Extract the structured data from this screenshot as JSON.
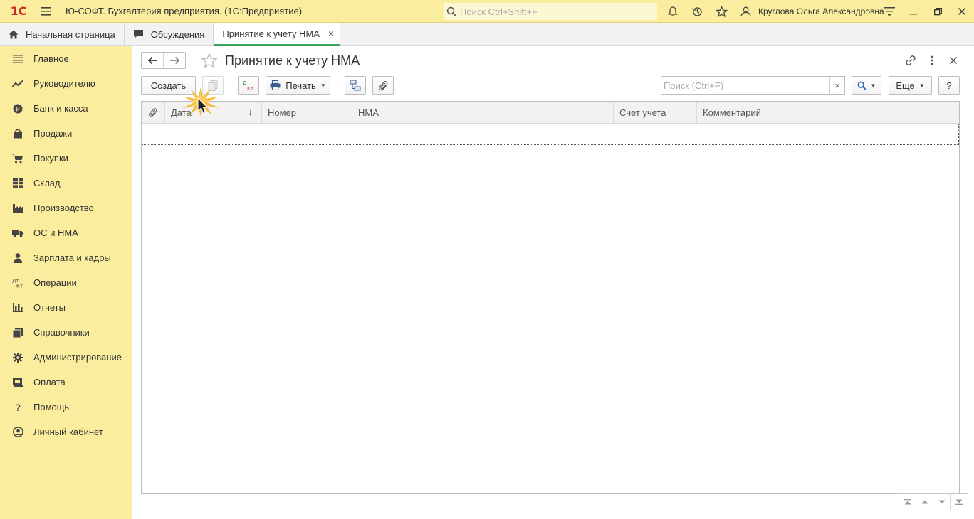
{
  "app": {
    "logo_text": "1С",
    "title": "Ю-СОФТ. Бухгалтерия предприятия.  (1С:Предприятие)",
    "search_placeholder": "Поиск Ctrl+Shift+F",
    "user_name": "Круглова Ольга Александровна",
    "icons": [
      "menu-icon",
      "search-icon",
      "bell-icon",
      "history-icon",
      "star-icon",
      "user-icon",
      "settings-icon"
    ],
    "accent_color": "#fbed9e"
  },
  "tabs": [
    {
      "label": "Начальная страница",
      "icon": "home-icon"
    },
    {
      "label": "Обсуждения",
      "icon": "chat-icon"
    },
    {
      "label": "Принятие к учету НМА",
      "active": true,
      "close": "×"
    }
  ],
  "sidebar": {
    "items": [
      {
        "label": "Главное",
        "icon": "list-icon"
      },
      {
        "label": "Руководителю",
        "icon": "trend-icon"
      },
      {
        "label": "Банк и касса",
        "icon": "coin-icon"
      },
      {
        "label": "Продажи",
        "icon": "bag-icon"
      },
      {
        "label": "Покупки",
        "icon": "cart-icon"
      },
      {
        "label": "Склад",
        "icon": "warehouse-icon"
      },
      {
        "label": "Производство",
        "icon": "factory-icon"
      },
      {
        "label": "ОС и НМА",
        "icon": "truck-icon"
      },
      {
        "label": "Зарплата и кадры",
        "icon": "person-icon"
      },
      {
        "label": "Операции",
        "icon": "dt-kt-icon"
      },
      {
        "label": "Отчеты",
        "icon": "bar-chart-icon"
      },
      {
        "label": "Справочники",
        "icon": "book-icon"
      },
      {
        "label": "Администрирование",
        "icon": "gear-icon"
      },
      {
        "label": "Оплата",
        "icon": "card-icon"
      },
      {
        "label": "Помощь",
        "icon": "question-icon"
      },
      {
        "label": "Личный кабинет",
        "icon": "account-icon"
      }
    ]
  },
  "form": {
    "title": "Принятие к учету НМА",
    "toolbar": {
      "create_label": "Создать",
      "print_label": "Печать",
      "search_placeholder": "Поиск (Ctrl+F)",
      "more_label": "Еще",
      "help_label": "?",
      "dtkt_top": "Дт",
      "dtkt_bottom": "Кт",
      "clear_label": "×"
    },
    "table": {
      "columns": [
        "",
        "Дата",
        "Номер",
        "НМА",
        "Счет учета",
        "Комментарий"
      ],
      "sort_indicator": "↓",
      "rows": []
    }
  }
}
